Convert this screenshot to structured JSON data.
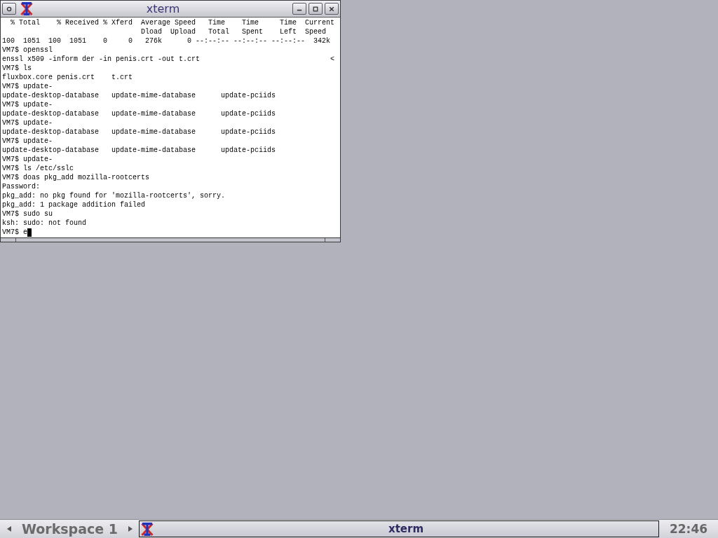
{
  "window": {
    "title": "xterm",
    "terminal": {
      "lines": [
        {
          "text": "  % Total    % Received % Xferd  Average Speed   Time    Time     Time  Current"
        },
        {
          "text": "                                 Dload  Upload   Total   Spent    Left  Speed"
        },
        {
          "text": "100  1051  100  1051    0     0   276k      0 --:--:-- --:--:-- --:--:--  342k"
        },
        {
          "text": "VM7$ openssl"
        },
        {
          "text": "enssl x509 -inform der -in penis.crt -out t.crt",
          "marker": "<"
        },
        {
          "text": "VM7$ ls"
        },
        {
          "text": "fluxbox.core penis.crt    t.crt"
        },
        {
          "text": "VM7$ update-"
        },
        {
          "text": "update-desktop-database   update-mime-database      update-pciids"
        },
        {
          "text": "VM7$ update-"
        },
        {
          "text": "update-desktop-database   update-mime-database      update-pciids"
        },
        {
          "text": "VM7$ update-"
        },
        {
          "text": "update-desktop-database   update-mime-database      update-pciids"
        },
        {
          "text": "VM7$ update-"
        },
        {
          "text": "update-desktop-database   update-mime-database      update-pciids"
        },
        {
          "text": "VM7$ update-"
        },
        {
          "text": "VM7$ ls /etc/sslc"
        },
        {
          "text": "VM7$ doas pkg_add mozilla-rootcerts"
        },
        {
          "text": "Password:"
        },
        {
          "text": "pkg_add: no pkg found for 'mozilla-rootcerts', sorry."
        },
        {
          "text": "pkg_add: 1 package addition failed"
        },
        {
          "text": "VM7$ sudo su"
        },
        {
          "text": "ksh: sudo: not found"
        }
      ],
      "input_line": {
        "text": "VM7$ e",
        "cursor": true
      }
    }
  },
  "taskbar": {
    "workspace": "Workspace 1",
    "tasks": [
      {
        "title": "xterm",
        "selected": true
      }
    ],
    "clock": "22:46"
  }
}
